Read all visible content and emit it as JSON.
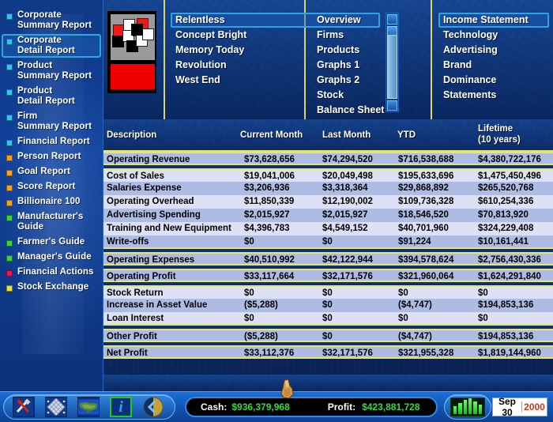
{
  "sidebar": {
    "items": [
      {
        "label": "Corporate\nSummary Report",
        "color": "#39c0ee",
        "selected": false
      },
      {
        "label": "Corporate\nDetail Report",
        "color": "#39c0ee",
        "selected": true
      },
      {
        "label": "Product\nSummary Report",
        "color": "#39c0ee",
        "selected": false
      },
      {
        "label": "Product\nDetail Report",
        "color": "#39c0ee",
        "selected": false
      },
      {
        "label": "Firm\nSummary Report",
        "color": "#39c0ee",
        "selected": false
      },
      {
        "label": "Financial Report",
        "color": "#39c0ee",
        "selected": false
      },
      {
        "label": "Person Report",
        "color": "#f5a21e",
        "selected": false
      },
      {
        "label": "Goal Report",
        "color": "#f5a21e",
        "selected": false
      },
      {
        "label": "Score Report",
        "color": "#f5a21e",
        "selected": false
      },
      {
        "label": "Billionaire 100",
        "color": "#f5a21e",
        "selected": false
      },
      {
        "label": "Manufacturer's\nGuide",
        "color": "#3ad23a",
        "selected": false
      },
      {
        "label": "Farmer's Guide",
        "color": "#3ad23a",
        "selected": false
      },
      {
        "label": "Manager's Guide",
        "color": "#3ad23a",
        "selected": false
      },
      {
        "label": "Financial Actions",
        "color": "#ee1556",
        "selected": false
      },
      {
        "label": "Stock Exchange",
        "color": "#e8e23c",
        "selected": false
      }
    ]
  },
  "companies": {
    "items": [
      {
        "label": "Relentless",
        "selected": true
      },
      {
        "label": "Concept Bright",
        "selected": false
      },
      {
        "label": "Memory Today",
        "selected": false
      },
      {
        "label": "Revolution",
        "selected": false
      },
      {
        "label": "West End",
        "selected": false
      }
    ]
  },
  "sections": {
    "items": [
      {
        "label": "Overview",
        "selected": false
      },
      {
        "label": "Firms",
        "selected": false
      },
      {
        "label": "Products",
        "selected": false
      },
      {
        "label": "Graphs 1",
        "selected": false
      },
      {
        "label": "Graphs 2",
        "selected": false
      },
      {
        "label": "Stock",
        "selected": false
      },
      {
        "label": "Balance Sheet",
        "selected": false
      }
    ]
  },
  "subsections": {
    "items": [
      {
        "label": "Income Statement",
        "selected": true
      },
      {
        "label": "Technology",
        "selected": false
      },
      {
        "label": "Advertising",
        "selected": false
      },
      {
        "label": "Brand",
        "selected": false
      },
      {
        "label": "Dominance",
        "selected": false
      },
      {
        "label": "Statements",
        "selected": false
      }
    ]
  },
  "table": {
    "headers": {
      "description": "Description",
      "current_month": "Current Month",
      "last_month": "Last Month",
      "ytd": "YTD",
      "lifetime_l1": "Lifetime",
      "lifetime_l2": "(10 years)"
    },
    "groups": [
      {
        "rows": [
          {
            "desc": "Operating Revenue",
            "current": "$73,628,656",
            "last": "$74,294,520",
            "ytd": "$716,538,688",
            "lifetime": "$4,380,722,176"
          }
        ]
      },
      {
        "rows": [
          {
            "desc": "Cost of Sales",
            "current": "$19,041,006",
            "last": "$20,049,498",
            "ytd": "$195,633,696",
            "lifetime": "$1,475,450,496"
          },
          {
            "desc": "Salaries Expense",
            "current": "$3,206,936",
            "last": "$3,318,364",
            "ytd": "$29,868,892",
            "lifetime": "$265,520,768"
          },
          {
            "desc": "Operating Overhead",
            "current": "$11,850,339",
            "last": "$12,190,002",
            "ytd": "$109,736,328",
            "lifetime": "$610,254,336"
          },
          {
            "desc": "Advertising Spending",
            "current": "$2,015,927",
            "last": "$2,015,927",
            "ytd": "$18,546,520",
            "lifetime": "$70,813,920"
          },
          {
            "desc": "Training and New Equipment",
            "current": "$4,396,783",
            "last": "$4,549,152",
            "ytd": "$40,701,960",
            "lifetime": "$324,229,408"
          },
          {
            "desc": "Write-offs",
            "current": "$0",
            "last": "$0",
            "ytd": "$91,224",
            "lifetime": "$10,161,441"
          }
        ]
      },
      {
        "rows": [
          {
            "desc": "Operating Expenses",
            "current": "$40,510,992",
            "last": "$42,122,944",
            "ytd": "$394,578,624",
            "lifetime": "$2,756,430,336"
          }
        ]
      },
      {
        "rows": [
          {
            "desc": "Operating Profit",
            "current": "$33,117,664",
            "last": "$32,171,576",
            "ytd": "$321,960,064",
            "lifetime": "$1,624,291,840"
          }
        ]
      },
      {
        "rows": [
          {
            "desc": "Stock Return",
            "current": "$0",
            "last": "$0",
            "ytd": "$0",
            "lifetime": "$0"
          },
          {
            "desc": "Increase in Asset Value",
            "current": "($5,288)",
            "last": "$0",
            "ytd": "($4,747)",
            "lifetime": "$194,853,136"
          },
          {
            "desc": "Loan Interest",
            "current": "$0",
            "last": "$0",
            "ytd": "$0",
            "lifetime": "$0"
          }
        ]
      },
      {
        "rows": [
          {
            "desc": "Other Profit",
            "current": "($5,288)",
            "last": "$0",
            "ytd": "($4,747)",
            "lifetime": "$194,853,136"
          }
        ]
      },
      {
        "rows": [
          {
            "desc": "Net Profit",
            "current": "$33,112,376",
            "last": "$32,171,576",
            "ytd": "$321,955,328",
            "lifetime": "$1,819,144,960"
          }
        ]
      }
    ],
    "highlight": {
      "target": "Operating Profit current month",
      "color": "#3ecb3e"
    }
  },
  "statusbar": {
    "buttons": [
      {
        "name": "tools-icon",
        "glyph": "tools"
      },
      {
        "name": "grid-map-icon",
        "glyph": "grid"
      },
      {
        "name": "world-map-icon",
        "glyph": "world"
      },
      {
        "name": "info-icon",
        "glyph": "i"
      },
      {
        "name": "back-icon",
        "glyph": "back"
      }
    ],
    "cash_label": "Cash:",
    "cash_value": "$936,379,968",
    "profit_label": "Profit:",
    "profit_value": "$423,881,728",
    "date_monthday": "Sep 30",
    "date_year": "2000",
    "speed_bars": 6
  },
  "colors": {
    "row_light": "#dde1f5",
    "row_dark": "#aebce4",
    "divider_yellow": "#e7e56d",
    "selection_border": "#28a6e2",
    "cash_green": "#2ee02e",
    "year_red": "#e03010"
  }
}
